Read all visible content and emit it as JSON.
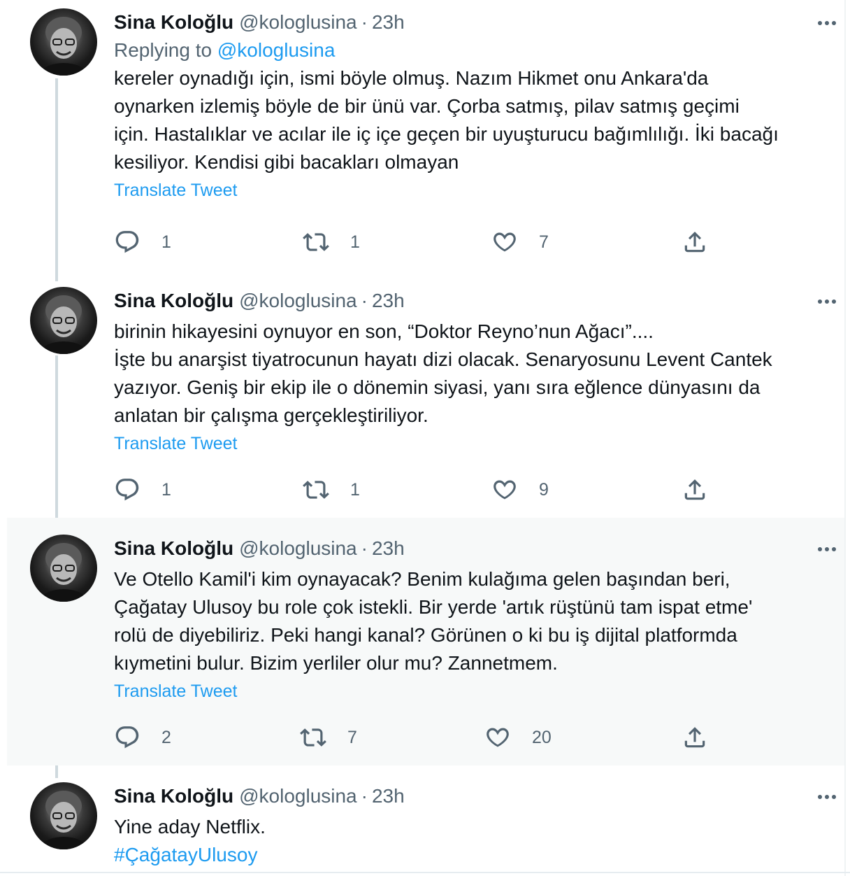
{
  "tweets": [
    {
      "author": "Sina Koloğlu",
      "handle": "@kologlusina",
      "dot": "·",
      "time": "23h",
      "replying_prefix": "Replying to ",
      "replying_to": "@kologlusina",
      "text": "kereler oynadığı için, ismi böyle olmuş. Nazım Hikmet onu Ankara'da\noynarken izlemiş böyle de bir ünü var. Çorba satmış, pilav satmış geçimi\niçin. Hastalıklar ve acılar ile iç içe geçen bir uyuşturucu bağımlılığı. İki bacağı\nkesiliyor. Kendisi gibi bacakları olmayan",
      "translate": "Translate Tweet",
      "replies": "1",
      "retweets": "1",
      "likes": "7"
    },
    {
      "author": "Sina Koloğlu",
      "handle": "@kologlusina",
      "dot": "·",
      "time": "23h",
      "text": "birinin hikayesini oynuyor en son, “Doktor Reyno’nun Ağacı”....\nİşte bu anarşist tiyatrocunun hayatı dizi olacak. Senaryosunu Levent Cantek\nyazıyor. Geniş bir ekip ile o dönemin siyasi, yanı sıra eğlence dünyasını da\nanlatan bir çalışma gerçekleştiriliyor.",
      "translate": "Translate Tweet",
      "replies": "1",
      "retweets": "1",
      "likes": "9"
    },
    {
      "author": "Sina Koloğlu",
      "handle": "@kologlusina",
      "dot": "·",
      "time": "23h",
      "text": "Ve Otello Kamil'i kim oynayacak? Benim kulağıma gelen başından beri,\nÇağatay Ulusoy bu role çok istekli. Bir yerde 'artık rüştünü tam ispat etme'\nrolü de diyebiliriz. Peki hangi kanal? Görünen o ki bu iş dijital platformda\nkıymetini bulur. Bizim yerliler olur mu? Zannetmem.",
      "translate": "Translate Tweet",
      "replies": "2",
      "retweets": "7",
      "likes": "20"
    },
    {
      "author": "Sina Koloğlu",
      "handle": "@kologlusina",
      "dot": "·",
      "time": "23h",
      "text": "Yine aday Netflix.",
      "hashtag": "#ÇağatayUlusoy"
    }
  ],
  "icons": {
    "reply": "reply-icon",
    "retweet": "retweet-icon",
    "like": "like-icon",
    "share": "share-icon",
    "more": "more-icon"
  },
  "colors": {
    "link": "#1d9bf0",
    "secondary_text": "#536471",
    "primary_text": "#0f1419",
    "highlight_bg": "#f7f9f9",
    "thread_line": "#cfd9de"
  }
}
